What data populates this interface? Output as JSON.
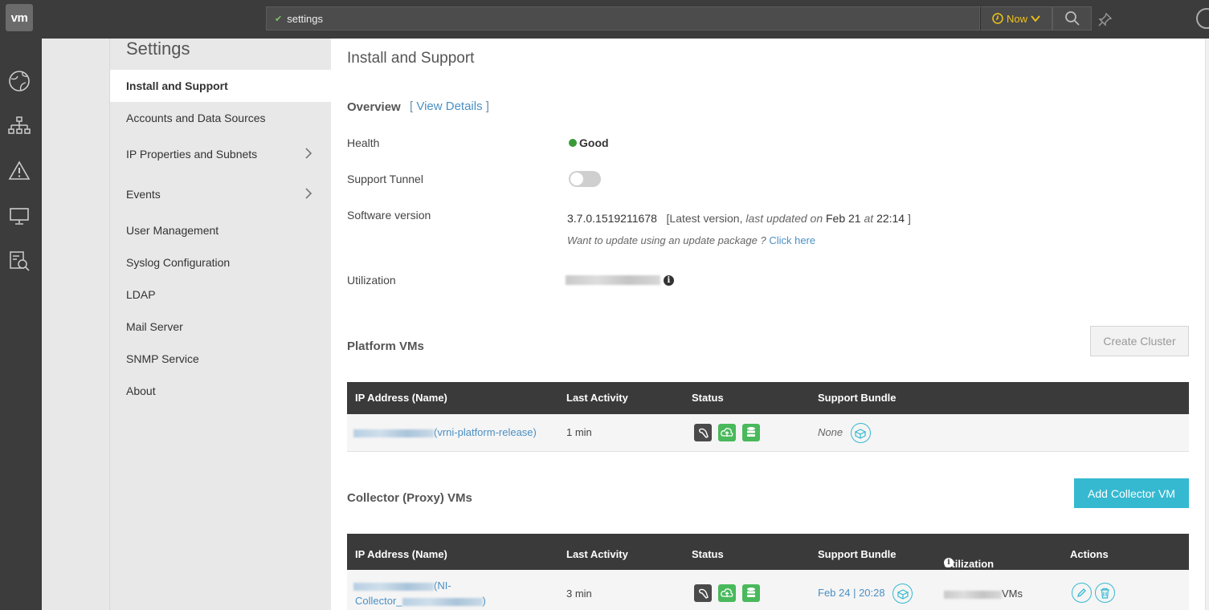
{
  "topbar": {
    "logo_text": "vm",
    "search_value": "settings",
    "time_label": "Now"
  },
  "sidebar": {
    "title": "Settings",
    "items": [
      {
        "label": "Install and Support",
        "active": true,
        "has_chevron": false
      },
      {
        "label": "Accounts and Data Sources",
        "active": false,
        "has_chevron": false
      },
      {
        "label": "IP Properties and Subnets",
        "active": false,
        "has_chevron": true
      },
      {
        "label": "Events",
        "active": false,
        "has_chevron": true
      },
      {
        "label": "User Management",
        "active": false,
        "has_chevron": false
      },
      {
        "label": "Syslog Configuration",
        "active": false,
        "has_chevron": false
      },
      {
        "label": "LDAP",
        "active": false,
        "has_chevron": false
      },
      {
        "label": "Mail Server",
        "active": false,
        "has_chevron": false
      },
      {
        "label": "SNMP Service",
        "active": false,
        "has_chevron": false
      },
      {
        "label": "About",
        "active": false,
        "has_chevron": false
      }
    ]
  },
  "main": {
    "title": "Install and Support",
    "overview": {
      "title": "Overview",
      "bracket_open": "[",
      "view_details": "View Details",
      "bracket_close": "]"
    },
    "health": {
      "label": "Health",
      "value": "Good"
    },
    "support_tunnel": {
      "label": "Support Tunnel",
      "enabled": false
    },
    "software": {
      "label": "Software version",
      "version": "3.7.0.1519211678",
      "latest_prefix": "[Latest version,",
      "last_updated_on": "last updated on",
      "date": "Feb 21",
      "at": "at",
      "time": "22:14",
      "suffix": "]",
      "update_prompt": "Want to update using an update package ?",
      "click_here": "Click here"
    },
    "utilization": {
      "label": "Utilization"
    },
    "platform": {
      "title": "Platform VMs",
      "create_cluster": "Create Cluster",
      "columns": [
        "IP Address (Name)",
        "Last Activity",
        "Status",
        "Support Bundle"
      ],
      "rows": [
        {
          "name": "(vrni-platform-release)",
          "last_activity": "1 min",
          "support_bundle": "None"
        }
      ]
    },
    "collector": {
      "title": "Collector (Proxy) VMs",
      "add_button": "Add Collector VM",
      "columns": [
        "IP Address (Name)",
        "Last Activity",
        "Status",
        "Support Bundle",
        "Utilization",
        "Actions"
      ],
      "rows": [
        {
          "name_part1": "(NI-",
          "name_part2": "Collector_",
          "name_part3": ")",
          "last_activity": "3 min",
          "support_bundle": "Feb 24 | 20:28",
          "utilization_suffix": "VMs"
        }
      ]
    }
  },
  "colors": {
    "accent": "#35b9d1",
    "health_good": "#3a9a3a",
    "status_green": "#49b95b",
    "link": "#4a90c4"
  }
}
